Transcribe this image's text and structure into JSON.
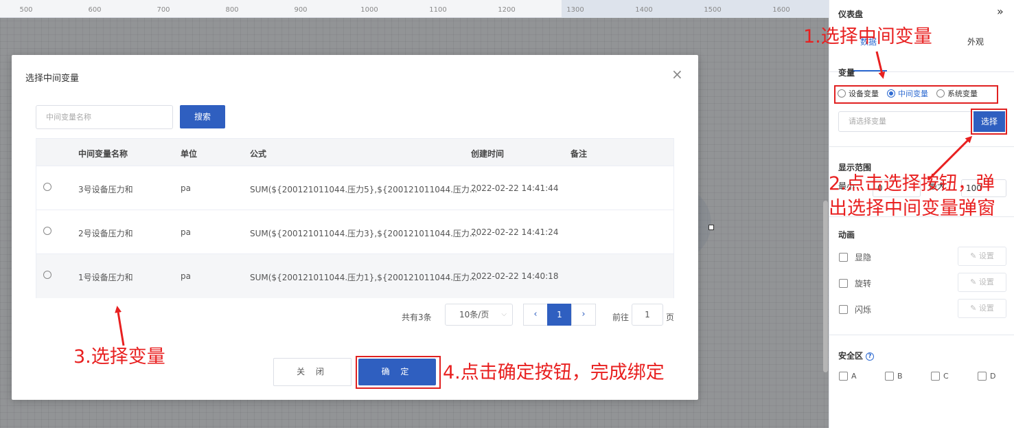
{
  "ruler": {
    "ticks": [
      "500",
      "600",
      "700",
      "800",
      "900",
      "1000",
      "1100",
      "1200",
      "1300",
      "1400",
      "1500",
      "1600"
    ]
  },
  "panel": {
    "title": "仪表盘",
    "collapse_icon": "»",
    "tabs": [
      {
        "label": "数据"
      },
      {
        "label": "外观"
      }
    ],
    "variable": {
      "title": "变量",
      "options": [
        {
          "label": "设备变量",
          "selected": false
        },
        {
          "label": "中间变量",
          "selected": true
        },
        {
          "label": "系统变量",
          "selected": false
        }
      ],
      "placeholder": "请选择变量",
      "choose_label": "选择"
    },
    "range": {
      "title": "显示范围",
      "min_label": "最小",
      "min_value": "0",
      "max_label": "最大",
      "max_value": "100"
    },
    "animation": {
      "title": "动画",
      "items": [
        {
          "label": "显隐",
          "set_label": "设置"
        },
        {
          "label": "旋转",
          "set_label": "设置"
        },
        {
          "label": "闪烁",
          "set_label": "设置"
        }
      ]
    },
    "safe_zone": {
      "title": "安全区",
      "options": [
        "A",
        "B",
        "C",
        "D"
      ]
    }
  },
  "dialog": {
    "title": "选择中间变量",
    "close_icon": "×",
    "search_placeholder": "中间变量名称",
    "search_label": "搜索",
    "columns": [
      "中间变量名称",
      "单位",
      "公式",
      "创建时间",
      "备注"
    ],
    "rows": [
      {
        "name": "3号设备压力和",
        "unit": "pa",
        "formula": "SUM(${200121011044.压力5},${200121011044.压力...",
        "created": "2022-02-22 14:41:44",
        "note": ""
      },
      {
        "name": "2号设备压力和",
        "unit": "pa",
        "formula": "SUM(${200121011044.压力3},${200121011044.压力...",
        "created": "2022-02-22 14:41:24",
        "note": ""
      },
      {
        "name": "1号设备压力和",
        "unit": "pa",
        "formula": "SUM(${200121011044.压力1},${200121011044.压力...",
        "created": "2022-02-22 14:40:18",
        "note": ""
      }
    ],
    "pagination": {
      "total_text": "共有3条",
      "page_size": "10条/页",
      "current": "1",
      "prev_icon": "‹",
      "next_icon": "›",
      "goto_label": "前往",
      "goto_value": "1",
      "page_suffix": "页"
    },
    "close_label": "关 闭",
    "confirm_label": "确 定"
  },
  "annotations": {
    "step1": "1.选择中间变量",
    "step2_line1": "2.点击选择按钮，弹",
    "step2_line2": "出选择中间变量弹窗",
    "step3": "3.选择变量",
    "step4": "4.点击确定按钮，完成绑定"
  },
  "colors": {
    "accent": "#2f5fc0",
    "annotation_red": "#e82020"
  }
}
